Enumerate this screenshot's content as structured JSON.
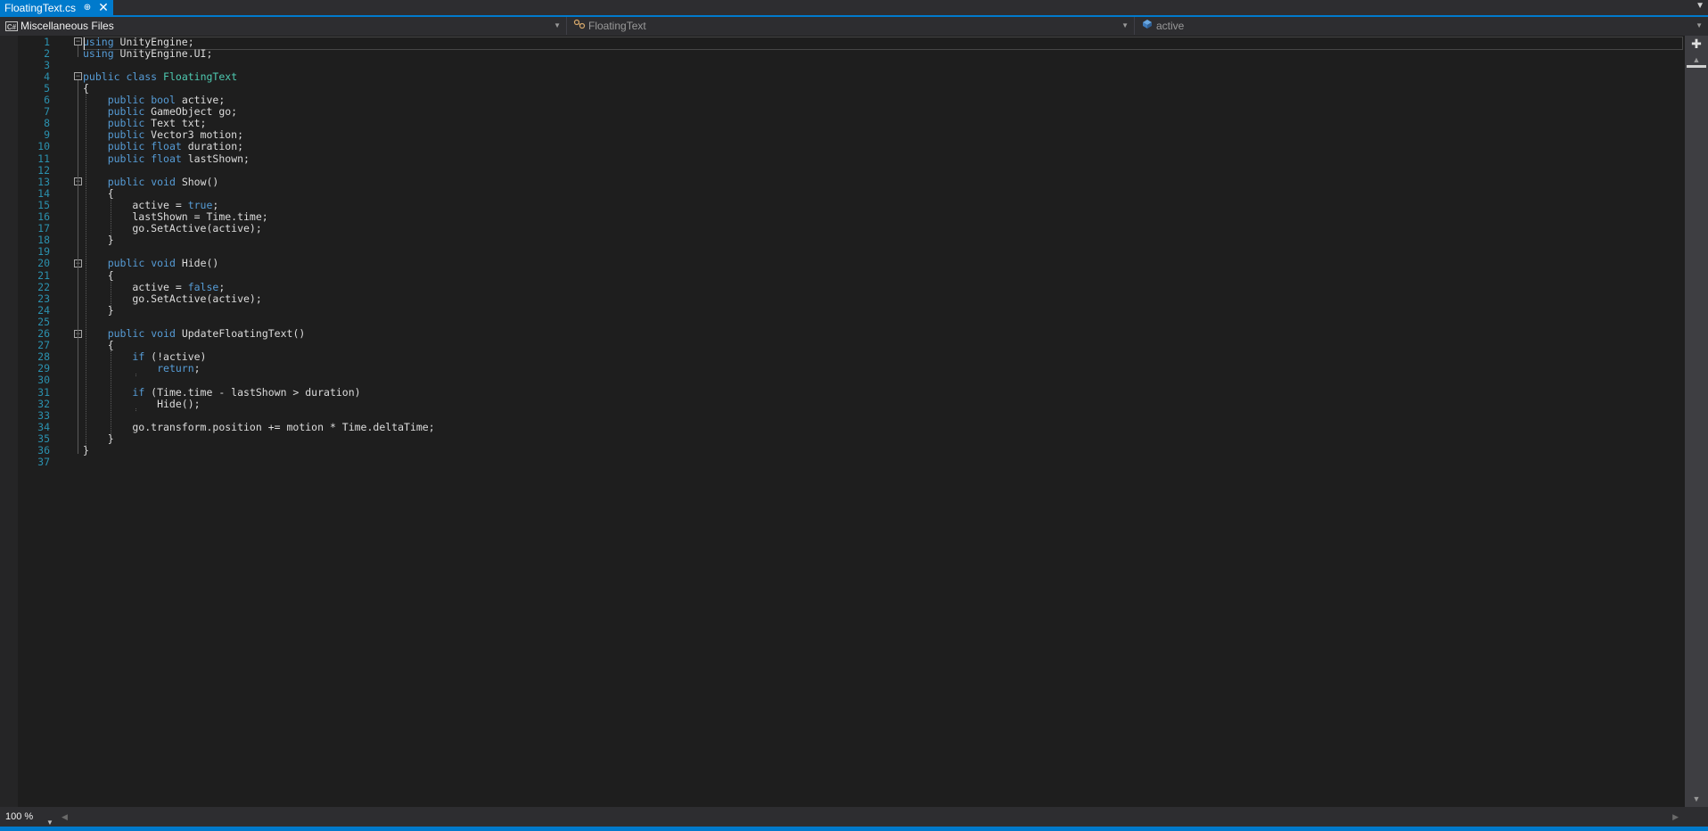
{
  "tab": {
    "title": "FloatingText.cs",
    "pin_glyph": "⊕",
    "close_glyph": "✕",
    "overflow_icon": "chevron-down-icon"
  },
  "navbar": {
    "project": "Miscellaneous Files",
    "project_icon": "csharp-project-icon",
    "type": "FloatingText",
    "type_icon": "class-icon",
    "member": "active",
    "member_icon": "field-icon"
  },
  "editor": {
    "line_numbers": [
      "1",
      "2",
      "3",
      "4",
      "5",
      "6",
      "7",
      "8",
      "9",
      "10",
      "11",
      "12",
      "13",
      "14",
      "15",
      "16",
      "17",
      "18",
      "19",
      "20",
      "21",
      "22",
      "23",
      "24",
      "25",
      "26",
      "27",
      "28",
      "29",
      "30",
      "31",
      "32",
      "33",
      "34",
      "35",
      "36",
      "37"
    ],
    "lines": [
      [
        [
          "kw",
          "using"
        ],
        [
          "p",
          " UnityEngine;"
        ]
      ],
      [
        [
          "kw",
          "using"
        ],
        [
          "p",
          " UnityEngine.UI;"
        ]
      ],
      [],
      [
        [
          "kw",
          "public"
        ],
        [
          "p",
          " "
        ],
        [
          "kw",
          "class"
        ],
        [
          "p",
          " "
        ],
        [
          "ty",
          "FloatingText"
        ]
      ],
      [
        [
          "p",
          "{"
        ]
      ],
      [
        [
          "p",
          "    "
        ],
        [
          "kw",
          "public"
        ],
        [
          "p",
          " "
        ],
        [
          "kw",
          "bool"
        ],
        [
          "p",
          " active;"
        ]
      ],
      [
        [
          "p",
          "    "
        ],
        [
          "kw",
          "public"
        ],
        [
          "p",
          " GameObject go;"
        ]
      ],
      [
        [
          "p",
          "    "
        ],
        [
          "kw",
          "public"
        ],
        [
          "p",
          " Text txt;"
        ]
      ],
      [
        [
          "p",
          "    "
        ],
        [
          "kw",
          "public"
        ],
        [
          "p",
          " Vector3 motion;"
        ]
      ],
      [
        [
          "p",
          "    "
        ],
        [
          "kw",
          "public"
        ],
        [
          "p",
          " "
        ],
        [
          "kw",
          "float"
        ],
        [
          "p",
          " duration;"
        ]
      ],
      [
        [
          "p",
          "    "
        ],
        [
          "kw",
          "public"
        ],
        [
          "p",
          " "
        ],
        [
          "kw",
          "float"
        ],
        [
          "p",
          " lastShown;"
        ]
      ],
      [],
      [
        [
          "p",
          "    "
        ],
        [
          "kw",
          "public"
        ],
        [
          "p",
          " "
        ],
        [
          "kw",
          "void"
        ],
        [
          "p",
          " Show()"
        ]
      ],
      [
        [
          "p",
          "    {"
        ]
      ],
      [
        [
          "p",
          "        active = "
        ],
        [
          "kw",
          "true"
        ],
        [
          "p",
          ";"
        ]
      ],
      [
        [
          "p",
          "        lastShown = Time.time;"
        ]
      ],
      [
        [
          "p",
          "        go.SetActive(active);"
        ]
      ],
      [
        [
          "p",
          "    }"
        ]
      ],
      [],
      [
        [
          "p",
          "    "
        ],
        [
          "kw",
          "public"
        ],
        [
          "p",
          " "
        ],
        [
          "kw",
          "void"
        ],
        [
          "p",
          " Hide()"
        ]
      ],
      [
        [
          "p",
          "    {"
        ]
      ],
      [
        [
          "p",
          "        active = "
        ],
        [
          "kw",
          "false"
        ],
        [
          "p",
          ";"
        ]
      ],
      [
        [
          "p",
          "        go.SetActive(active);"
        ]
      ],
      [
        [
          "p",
          "    }"
        ]
      ],
      [],
      [
        [
          "p",
          "    "
        ],
        [
          "kw",
          "public"
        ],
        [
          "p",
          " "
        ],
        [
          "kw",
          "void"
        ],
        [
          "p",
          " UpdateFloatingText()"
        ]
      ],
      [
        [
          "p",
          "    {"
        ]
      ],
      [
        [
          "p",
          "        "
        ],
        [
          "kw",
          "if"
        ],
        [
          "p",
          " (!active)"
        ]
      ],
      [
        [
          "p",
          "            "
        ],
        [
          "kw",
          "return"
        ],
        [
          "p",
          ";"
        ]
      ],
      [],
      [
        [
          "p",
          "        "
        ],
        [
          "kw",
          "if"
        ],
        [
          "p",
          " (Time.time - lastShown > duration)"
        ]
      ],
      [
        [
          "p",
          "            Hide();"
        ]
      ],
      [],
      [
        [
          "p",
          "        go.transform.position += motion * Time.deltaTime;"
        ]
      ],
      [
        [
          "p",
          "    }"
        ]
      ],
      [
        [
          "p",
          "}"
        ]
      ],
      []
    ]
  },
  "bottombar": {
    "zoom": "100 %"
  },
  "colors": {
    "accent": "#007acc",
    "keyword": "#569cd6",
    "type": "#4ec9b0",
    "line_number": "#2b91af",
    "text": "#dcdcdc",
    "background": "#1e1e1e"
  }
}
